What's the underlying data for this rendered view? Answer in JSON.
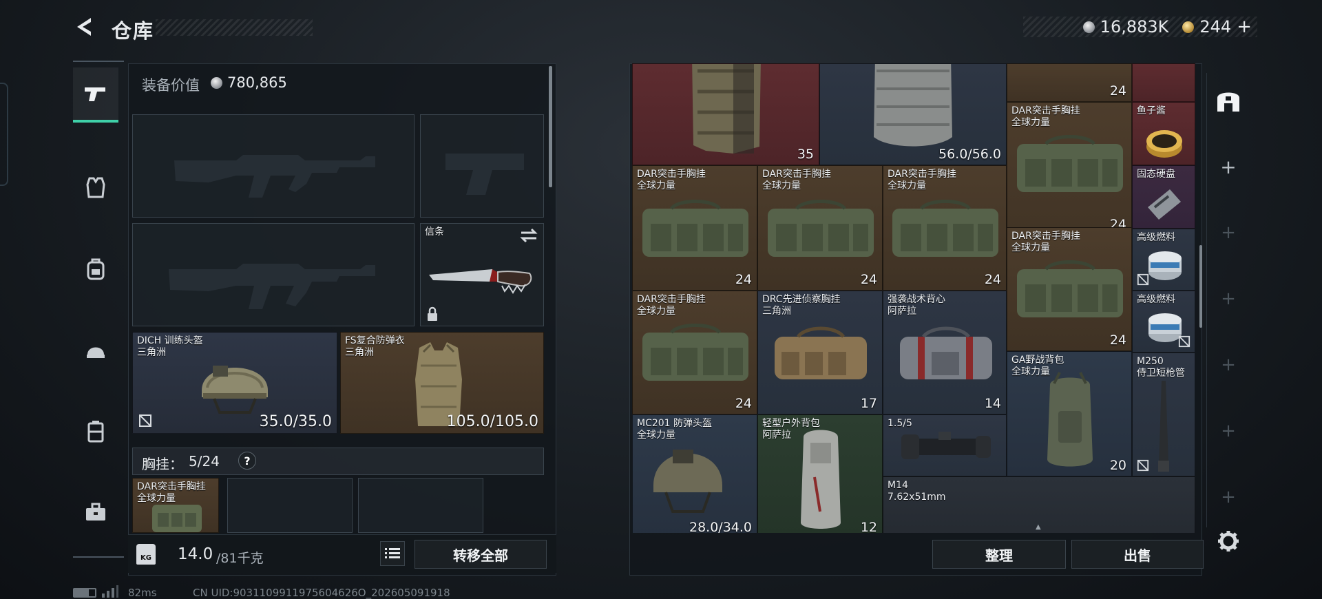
{
  "header": {
    "title": "仓库",
    "currency": "16,883K",
    "tokens": "244",
    "plus": "+"
  },
  "left_panel": {
    "equip_value_label": "装备价值",
    "equip_value": "780,865",
    "slot_label": "信条",
    "helmet": {
      "name": "DICH 训练头盔",
      "sub": "三角洲",
      "durability": "35.0/35.0"
    },
    "armor": {
      "name": "FS复合防弹衣",
      "sub": "三角洲",
      "durability": "105.0/105.0"
    },
    "rig_label": "胸挂：",
    "rig_capacity": "5/24",
    "rig_help": "?",
    "rig_item": {
      "name": "DAR突击手胸挂",
      "sub": "全球力量"
    },
    "weight_icon_text": "KG",
    "weight": "14.0",
    "weight_max": "/81千克",
    "transfer_all": "转移全部"
  },
  "right_panel": {
    "organize": "整理",
    "sell": "出售",
    "scroll_hint": "▲",
    "items": [
      {
        "name": "",
        "sub": "",
        "badge": "35"
      },
      {
        "name": "",
        "sub": "",
        "badge": "56.0/56.0"
      },
      {
        "name": "",
        "sub": "",
        "badge": "24"
      },
      {
        "name": "DAR突击手胸挂",
        "sub": "全球力量",
        "badge": "24"
      },
      {
        "name": "鱼子酱",
        "sub": "",
        "badge": ""
      },
      {
        "name": "固态硬盘",
        "sub": "",
        "badge": ""
      },
      {
        "name": "DAR突击手胸挂",
        "sub": "全球力量",
        "badge": "24"
      },
      {
        "name": "DAR突击手胸挂",
        "sub": "全球力量",
        "badge": "24"
      },
      {
        "name": "DAR突击手胸挂",
        "sub": "全球力量",
        "badge": "24"
      },
      {
        "name": "DAR突击手胸挂",
        "sub": "全球力量",
        "badge": "24"
      },
      {
        "name": "高级燃料",
        "sub": "",
        "badge": ""
      },
      {
        "name": "高级燃料",
        "sub": "",
        "badge": ""
      },
      {
        "name": "DAR突击手胸挂",
        "sub": "全球力量",
        "badge": "24"
      },
      {
        "name": "DRC先进侦察胸挂",
        "sub": "三角洲",
        "badge": "17"
      },
      {
        "name": "强袭战术背心",
        "sub": "阿萨拉",
        "badge": "14"
      },
      {
        "name": "GA野战背包",
        "sub": "全球力量",
        "badge": "20"
      },
      {
        "name": "M250",
        "sub": "侍卫短枪管",
        "badge": ""
      },
      {
        "name": "MC201 防弹头盔",
        "sub": "全球力量",
        "badge": "28.0/34.0"
      },
      {
        "name": "轻型户外背包",
        "sub": "阿萨拉",
        "badge": "12"
      },
      {
        "name": "1.5/5",
        "sub": "",
        "badge": ""
      },
      {
        "name": "M14",
        "sub": "7.62x51mm",
        "badge": ""
      }
    ]
  },
  "footer": {
    "ping": "82ms",
    "uid": "CN UID:9031109911975604626O_202605091918"
  },
  "colors": {
    "accent": "#3fd0a8",
    "panel": "#14191e",
    "red_cell": "#5a2a2e",
    "brown_cell": "#4a3a2a",
    "blue_cell": "#2c3644",
    "green_cell": "#2b3a2e"
  },
  "icons": [
    "back-arrow-icon",
    "pistol-icon",
    "vest-icon",
    "backpack-icon",
    "helmet-icon",
    "case-icon",
    "toolbox-icon",
    "shelter-icon",
    "plus-icon",
    "gear-icon",
    "swap-icon",
    "lock-icon",
    "no-entry-icon",
    "list-icon",
    "weight-icon",
    "battery-icon",
    "signal-icon"
  ]
}
